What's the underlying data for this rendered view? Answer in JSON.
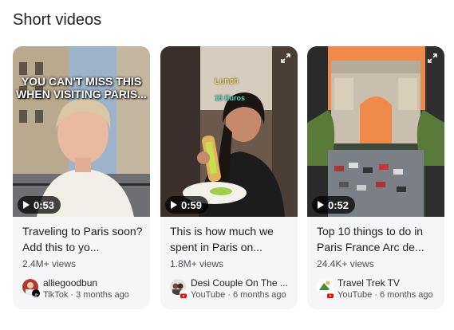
{
  "section": {
    "title": "Short videos"
  },
  "videos": [
    {
      "overlay": "YOU CAN'T MISS THIS WHEN VISITING PARIS...",
      "handle": "@alliegoodbun",
      "duration": "0:53",
      "title": "Traveling to Paris soon? Add this to yo...",
      "views": "2.4M+ views",
      "channel": "alliegoodbun",
      "source": "TikTok",
      "age": "3 months ago",
      "meta": "TikTok · 3 months ago"
    },
    {
      "overlay_line1": "Lunch",
      "overlay_line2": "15 Euros",
      "duration": "0:59",
      "title": "This is how much we spent in Paris on...",
      "views": "1.8M+ views",
      "channel": "Desi Couple On The ...",
      "source": "YouTube",
      "age": "6 months ago",
      "meta": "YouTube · 6 months ago"
    },
    {
      "duration": "0:52",
      "title": "Top 10 things to do in Paris France Arc de...",
      "views": "24.4K+ views",
      "channel": "Travel Trek TV",
      "source": "YouTube",
      "age": "6 months ago",
      "meta": "YouTube · 6 months ago"
    }
  ],
  "colors": {
    "youtube": "#ff0000",
    "tiktok": "#000000",
    "card_bg": "#f5f6f8"
  }
}
